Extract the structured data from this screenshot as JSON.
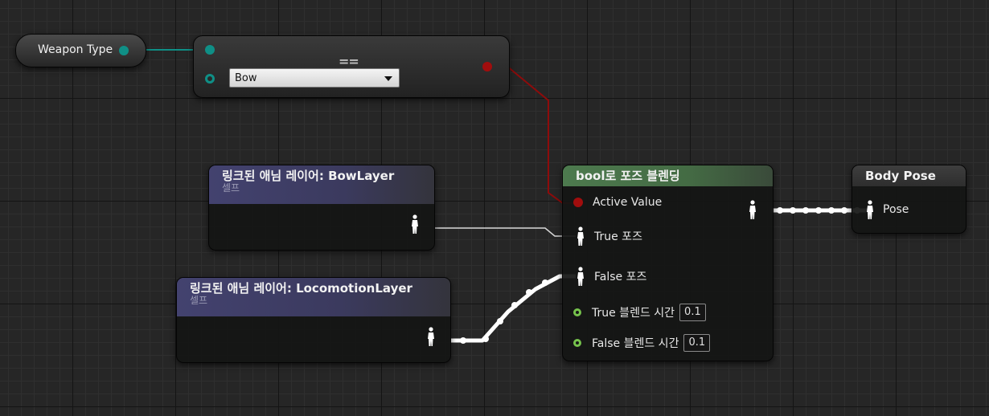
{
  "weapon_node": {
    "label": "Weapon Type"
  },
  "select_node": {
    "title": "",
    "separator": "==",
    "selected_option": "Bow"
  },
  "bow_layer_node": {
    "title": "링크된 애님 레이어: BowLayer",
    "subtitle": "셀프"
  },
  "locomotion_layer_node": {
    "title": "링크된 애님 레이어: LocomotionLayer",
    "subtitle": "셀프"
  },
  "blend_node": {
    "title": "bool로 포즈 블렌딩",
    "active_value_label": "Active Value",
    "true_pose_label": "True 포즈",
    "false_pose_label": "False 포즈",
    "true_blend_label": "True 블렌드 시간",
    "true_blend_value": "0.1",
    "false_blend_label": "False 블렌드 시간",
    "false_blend_value": "0.1"
  },
  "output_node": {
    "title": "Body Pose",
    "pose_label": "Pose"
  },
  "colors": {
    "enum_pin": "#0f8f86",
    "bool_pin": "#a10d0d",
    "float_pin": "#76c34c",
    "purple_header": "#43426f",
    "green_header": "#4d7a4e"
  }
}
